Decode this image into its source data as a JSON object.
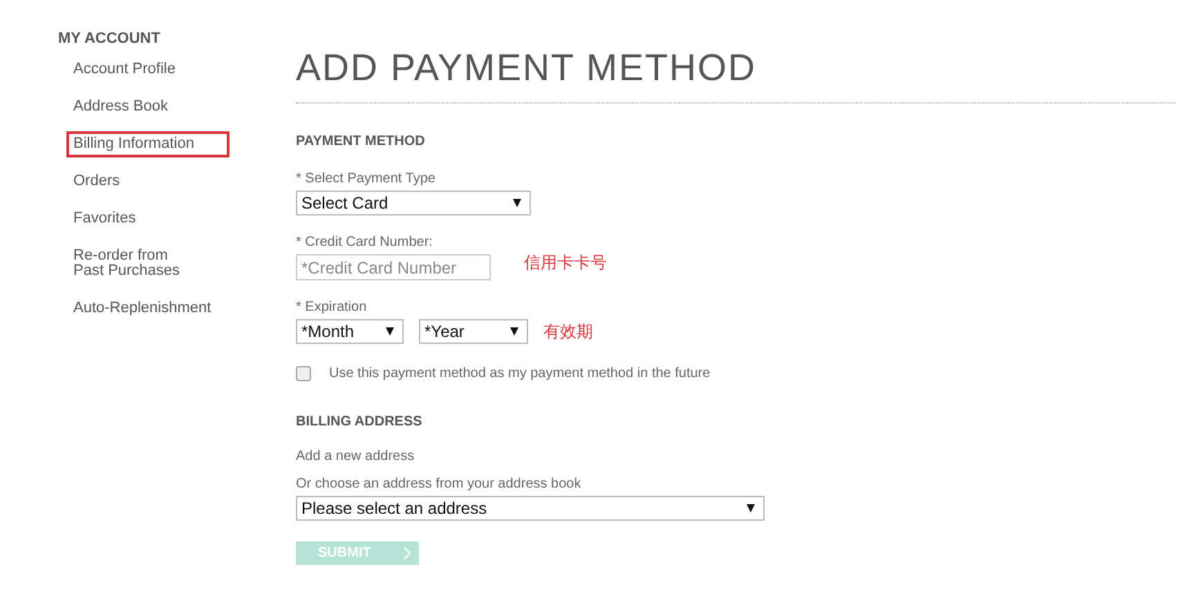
{
  "sidebar": {
    "heading": "MY ACCOUNT",
    "items": [
      {
        "label": "Account Profile",
        "highlighted": false
      },
      {
        "label": "Address Book",
        "highlighted": false
      },
      {
        "label": "Billing Information",
        "highlighted": true
      },
      {
        "label": "Orders",
        "highlighted": false
      },
      {
        "label": "Favorites",
        "highlighted": false
      },
      {
        "label": "Re-order from\nPast Purchases",
        "highlighted": false
      },
      {
        "label": "Auto-Replenishment",
        "highlighted": false
      }
    ]
  },
  "page_title": "ADD PAYMENT METHOD",
  "payment_method": {
    "heading": "PAYMENT METHOD",
    "payment_type": {
      "label": "* Select Payment Type",
      "value": "Select Card"
    },
    "card_number": {
      "label": "* Credit Card Number:",
      "placeholder": "*Credit Card Number",
      "annotation": "信用卡卡号"
    },
    "expiration": {
      "label": "* Expiration",
      "month": "*Month",
      "year": "*Year",
      "annotation": "有效期"
    },
    "save_option": {
      "label": "Use this payment method as my payment method in the future",
      "checked": false
    }
  },
  "billing_address": {
    "heading": "BILLING ADDRESS",
    "add_new_link": "Add a new address",
    "choose_label": "Or choose an address from your address book",
    "address_select": "Please select an address"
  },
  "submit": {
    "label": "SUBMIT",
    "disabled": true
  }
}
